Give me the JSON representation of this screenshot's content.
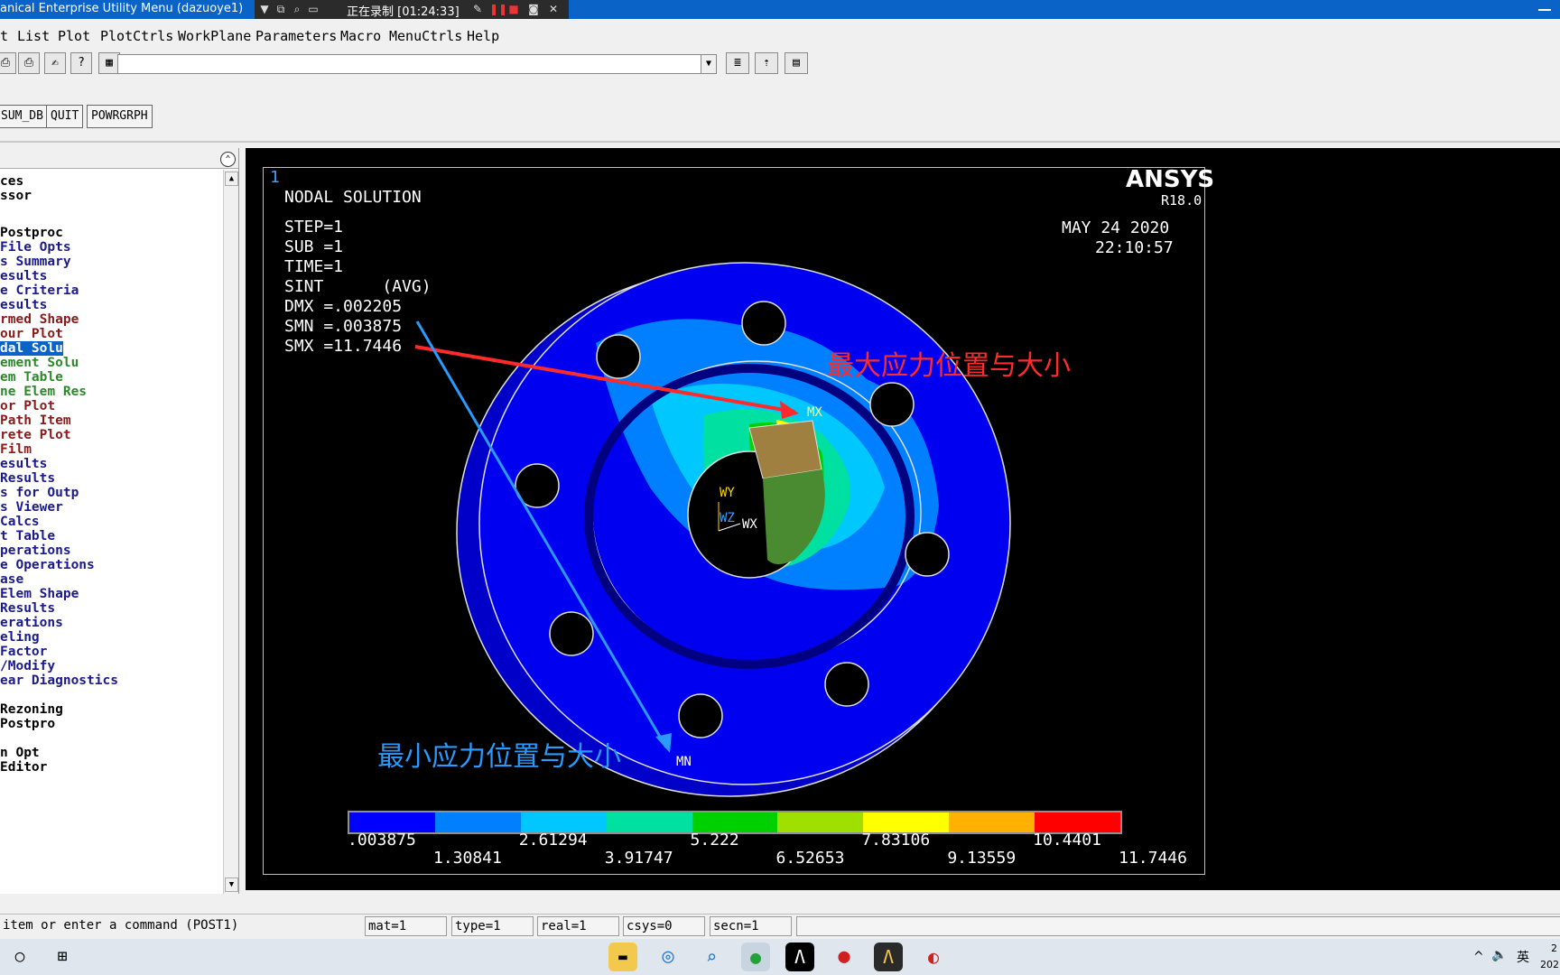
{
  "titlebar": {
    "title": "anical Enterprise Utility Menu (dazuoye1)",
    "recording": "正在录制 [01:24:33]"
  },
  "menu": [
    "t",
    "List",
    "Plot",
    "PlotCtrls",
    "WorkPlane",
    "Parameters",
    "Macro",
    "MenuCtrls",
    "Help"
  ],
  "toolbar": {
    "command_value": ""
  },
  "buttons": [
    "SUM_DB",
    "QUIT",
    "POWRGRPH"
  ],
  "tree": {
    "items": [
      {
        "text": "ces",
        "color": "#000000"
      },
      {
        "text": "ssor",
        "color": "#000000"
      },
      {
        "text": "Postproc",
        "color": "#000000"
      },
      {
        "text": " File Opts",
        "color": "#1a1a8c"
      },
      {
        "text": "s Summary",
        "color": "#1a1a8c"
      },
      {
        "text": "esults",
        "color": "#1a1a8c"
      },
      {
        "text": "e Criteria",
        "color": "#1a1a8c"
      },
      {
        "text": "esults",
        "color": "#1a1a8c"
      },
      {
        "text": "rmed Shape",
        "color": "#8b1a1a"
      },
      {
        "text": "our Plot",
        "color": "#8b1a1a"
      },
      {
        "text": "dal Solu",
        "color": "#ffffff",
        "selected": true
      },
      {
        "text": "ement Solu",
        "color": "#2a8a2a"
      },
      {
        "text": "em Table",
        "color": "#2a8a2a"
      },
      {
        "text": "ne Elem Res",
        "color": "#2a8a2a"
      },
      {
        "text": "or Plot",
        "color": "#8b1a1a"
      },
      {
        "text": " Path Item",
        "color": "#8b1a1a"
      },
      {
        "text": "rete Plot",
        "color": "#8b1a1a"
      },
      {
        "text": "Film",
        "color": "#8b1a1a"
      },
      {
        "text": "esults",
        "color": "#1a1a8c"
      },
      {
        "text": "Results",
        "color": "#1a1a8c"
      },
      {
        "text": "s for Outp",
        "color": "#1a1a8c"
      },
      {
        "text": "s Viewer",
        "color": "#1a1a8c"
      },
      {
        "text": "Calcs",
        "color": "#1a1a8c"
      },
      {
        "text": "t Table",
        "color": "#1a1a8c"
      },
      {
        "text": "perations",
        "color": "#1a1a8c"
      },
      {
        "text": "e Operations",
        "color": "#1a1a8c"
      },
      {
        "text": "ase",
        "color": "#1a1a8c"
      },
      {
        "text": "Elem Shape",
        "color": "#1a1a8c"
      },
      {
        "text": "Results",
        "color": "#1a1a8c"
      },
      {
        "text": "erations",
        "color": "#1a1a8c"
      },
      {
        "text": "eling",
        "color": "#1a1a8c"
      },
      {
        "text": " Factor",
        "color": "#1a1a8c"
      },
      {
        "text": "/Modify",
        "color": "#1a1a8c"
      },
      {
        "text": "ear Diagnostics",
        "color": "#1a1a8c"
      },
      {
        "text": " Rezoning",
        "color": "#000000"
      },
      {
        "text": " Postpro",
        "color": "#000000"
      },
      {
        "text": "n Opt",
        "color": "#000000"
      },
      {
        "text": "Editor",
        "color": "#000000"
      }
    ]
  },
  "graphics": {
    "window_number": "1",
    "title": "NODAL SOLUTION",
    "info": [
      "STEP=1",
      "SUB =1",
      "TIME=1",
      "SINT      (AVG)",
      "DMX =.002205",
      "SMN =.003875",
      "SMX =11.7446"
    ],
    "brand": "ANSYS",
    "version": "R18.0",
    "date": "MAY 24 2020",
    "time": "22:10:57",
    "mx_label": "MX",
    "mn_label": "MN",
    "wy": "WY",
    "wz": "WZ",
    "wx": "WX",
    "annotation_max": "最大应力位置与大小",
    "annotation_min": "最小应力位置与大小",
    "legend": {
      "colors": [
        "#0000ff",
        "#0080ff",
        "#00c8ff",
        "#00e0a0",
        "#00d000",
        "#a0e000",
        "#ffff00",
        "#ffb000",
        "#ff0000"
      ],
      "top_labels": [
        ".003875",
        "2.61294",
        "5.222",
        "7.83106",
        "10.4401"
      ],
      "bottom_labels": [
        "1.30841",
        "3.91747",
        "6.52653",
        "9.13559",
        "11.7446"
      ]
    }
  },
  "status": {
    "prompt": " item or enter a command (POST1)",
    "mat": "mat=1",
    "type": "type=1",
    "real": "real=1",
    "csys": "csys=0",
    "secn": "secn=1"
  },
  "taskbar": {
    "ime": "英",
    "volume": "🔈",
    "time_partial": "2",
    "date_partial": "202"
  }
}
